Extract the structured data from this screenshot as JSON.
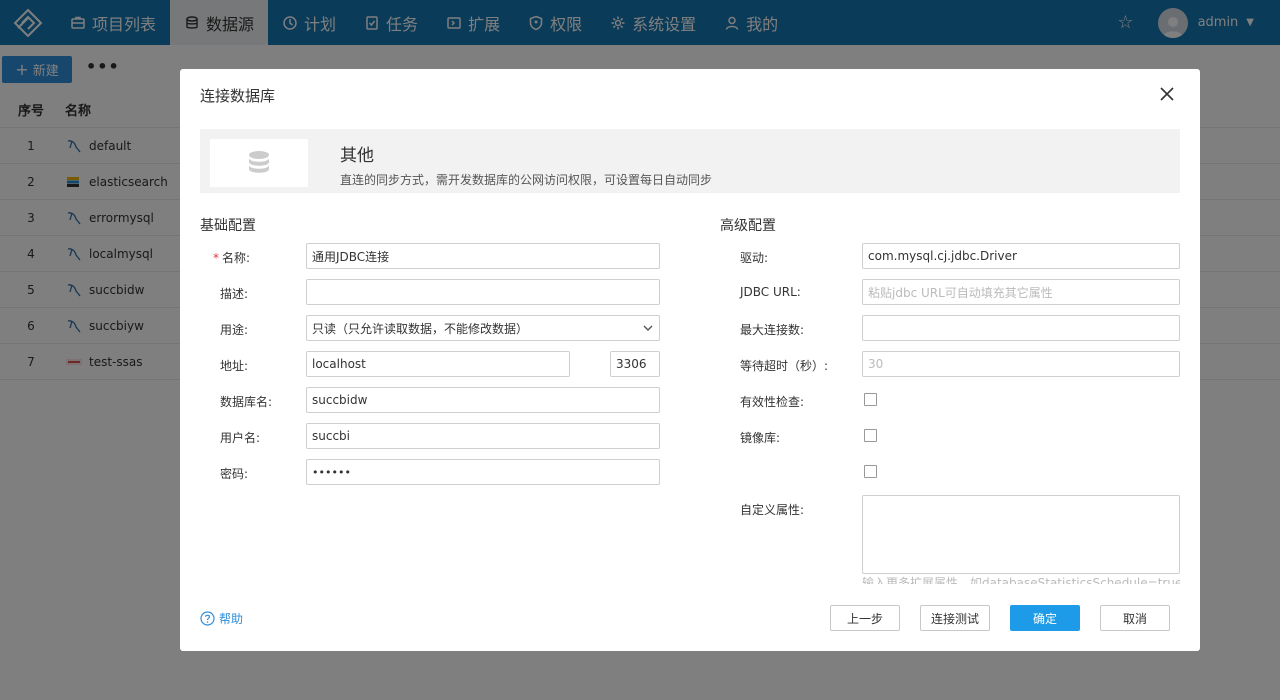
{
  "topbar": {
    "nav": [
      {
        "label": "项目列表",
        "icon": "project-list-icon"
      },
      {
        "label": "数据源",
        "icon": "database-icon",
        "active": true
      },
      {
        "label": "计划",
        "icon": "clock-icon"
      },
      {
        "label": "任务",
        "icon": "task-icon"
      },
      {
        "label": "扩展",
        "icon": "extension-icon"
      },
      {
        "label": "权限",
        "icon": "shield-icon"
      },
      {
        "label": "系统设置",
        "icon": "gear-icon"
      },
      {
        "label": "我的",
        "icon": "user-icon"
      }
    ],
    "user": "admin",
    "colors": {
      "bar": "#1576b3",
      "active_tab": "#eef0f2"
    }
  },
  "toolbar": {
    "new_label": "新建",
    "more_label": "•••"
  },
  "table": {
    "headers": {
      "no": "序号",
      "name": "名称"
    },
    "rows": [
      {
        "no": "1",
        "name": "default",
        "icon": "mysql-icon"
      },
      {
        "no": "2",
        "name": "elasticsearch",
        "icon": "elasticsearch-icon"
      },
      {
        "no": "3",
        "name": "errormysql",
        "icon": "mysql-icon"
      },
      {
        "no": "4",
        "name": "localmysql",
        "icon": "mysql-icon"
      },
      {
        "no": "5",
        "name": "succbidw",
        "icon": "mysql-icon"
      },
      {
        "no": "6",
        "name": "succbiyw",
        "icon": "mysql-icon"
      },
      {
        "no": "7",
        "name": "test-ssas",
        "icon": "ssas-icon"
      }
    ]
  },
  "modal": {
    "title": "连接数据库",
    "type_name": "其他",
    "type_desc": "直连的同步方式，需开发数据库的公网访问权限，可设置每日自动同步",
    "basic": {
      "title": "基础配置",
      "name_label": "名称:",
      "name_required": "*",
      "name_value": "通用JDBC连接",
      "desc_label": "描述:",
      "desc_value": "",
      "usage_label": "用途:",
      "usage_value": "只读（只允许读取数据，不能修改数据）",
      "address_label": "地址:",
      "host_value": "localhost",
      "port_value": "3306",
      "dbname_label": "数据库名:",
      "dbname_value": "succbidw",
      "user_label": "用户名:",
      "user_value": "succbi",
      "password_label": "密码:",
      "password_value": "••••••"
    },
    "advanced": {
      "title": "高级配置",
      "driver_label": "驱动:",
      "driver_value": "com.mysql.cj.jdbc.Driver",
      "jdbc_label": "JDBC URL:",
      "jdbc_placeholder": "粘贴jdbc URL可自动填充其它属性",
      "maxconn_label": "最大连接数:",
      "maxconn_value": "",
      "timeout_label": "等待超时（秒）:",
      "timeout_placeholder": "30",
      "validity_label": "有效性检查:",
      "mirror_label": "镜像库:",
      "custom_label": "自定义属性:",
      "custom_hint": "输入更多扩展属性，如databaseStatisticsSchedule=true"
    },
    "help_label": "帮助",
    "buttons": {
      "prev": "上一步",
      "test": "连接测试",
      "ok": "确定",
      "cancel": "取消"
    },
    "colors": {
      "primary": "#1e9be8",
      "link": "#2f8fd8"
    }
  }
}
